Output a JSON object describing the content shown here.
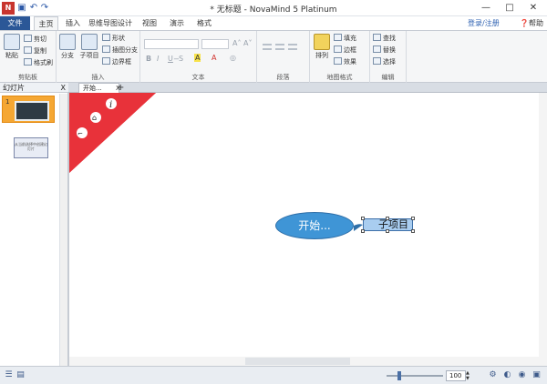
{
  "window": {
    "title": "* 无标题 - NovaMind 5 Platinum",
    "minimize_icon": "minimize-icon",
    "maximize_icon": "maximize-icon",
    "close_icon": "close-icon"
  },
  "quick_access": [
    "save-icon",
    "undo-icon",
    "redo-icon"
  ],
  "ribbon_tabs": [
    {
      "label": "文件"
    },
    {
      "label": "主页"
    },
    {
      "label": "插入"
    },
    {
      "label": "思维导图设计"
    },
    {
      "label": "视图"
    },
    {
      "label": "演示"
    },
    {
      "label": "格式"
    }
  ],
  "header_right": {
    "login": "登录/注册",
    "help": "帮助"
  },
  "ribbon": {
    "clipboard": {
      "label": "剪贴板",
      "paste": "粘贴",
      "cut": "剪切",
      "copy": "复制",
      "format_painter": "格式刷"
    },
    "insert": {
      "label": "插入",
      "sibling": "分支",
      "child": "子项目",
      "shape": "形状",
      "branch": "插图分支",
      "boundary": "边界框"
    },
    "text": {
      "label": "文本",
      "bold": "B",
      "italic": "I",
      "underline": "U"
    },
    "paragraph": {
      "label": "段落"
    },
    "map_format": {
      "label": "地图格式",
      "arrange": "排列",
      "fill": "填充",
      "border": "边框",
      "effects": "效果"
    },
    "editing": {
      "label": "编辑",
      "find": "查找",
      "replace": "替换",
      "select": "选择"
    }
  },
  "slides_panel": {
    "title": "幻灯片",
    "close": "X",
    "slide_number": "1",
    "placeholder": "从当前选择中创建幻灯片"
  },
  "doc_tab": {
    "label": "开始...",
    "close": "X",
    "new_tab": "+"
  },
  "canvas": {
    "root_topic": "开始...",
    "child_topic": "子项目"
  },
  "statusbar": {
    "zoom_value": "100",
    "zoom_level": 0.22
  },
  "colors": {
    "file_tab": "#2b5797",
    "slide_selected": "#f5a733",
    "ribbon_corner": "#e8333a",
    "root_node": "#3f95d6",
    "child_node": "#a9cdf0"
  }
}
